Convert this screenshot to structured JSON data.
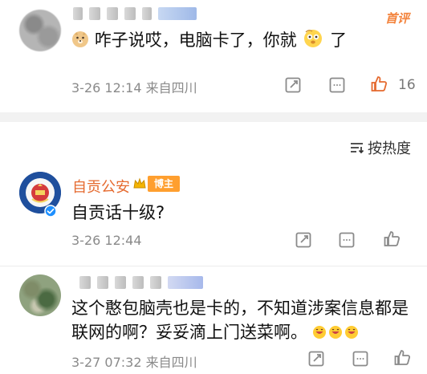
{
  "comment1": {
    "reply_tag": "首评",
    "text_prefix": "咋子说哎，电脑卡了，你就",
    "text_suffix": "了",
    "meta": "3-26 12:14  来自四川",
    "like_count": "16"
  },
  "sort": {
    "label": "按热度"
  },
  "comment2": {
    "author": "自贡公安",
    "badge": "博主",
    "text": "自贡话十级?",
    "meta": "3-26 12:44"
  },
  "comment3": {
    "line1": "这个憨包脑壳也是卡的，不知道涉案信息都是",
    "line2": "联网的啊？妥妥滴上门送菜啊。",
    "meta": "3-27 07:32  来自四川"
  },
  "colors": {
    "accent": "#e56a2f",
    "like_active": "#e56a2f",
    "badge_bg": "#ff9f2f",
    "divider": "#f2f2f2"
  },
  "icons": {
    "comment1_avatar": "blurred-avatar-icon",
    "comment1_emoji_left": "doge-emoji-icon",
    "comment1_emoji_right": "thinking-emoji-icon",
    "comment1_share": "share-icon",
    "comment1_reply": "comment-icon",
    "comment1_like": "thumb-up-icon",
    "sort": "sort-icon",
    "comment2_avatar": "police-emblem-icon",
    "comment2_verified": "verified-icon",
    "comment2_crown": "crown-icon",
    "comment2_share": "share-icon",
    "comment2_reply": "comment-icon",
    "comment2_like": "thumb-up-icon",
    "comment3_avatar": "blurred-avatar-icon",
    "comment3_emoji": "laughing-emoji-icon",
    "comment3_share": "share-icon",
    "comment3_reply": "comment-icon",
    "comment3_like": "thumb-up-icon"
  }
}
